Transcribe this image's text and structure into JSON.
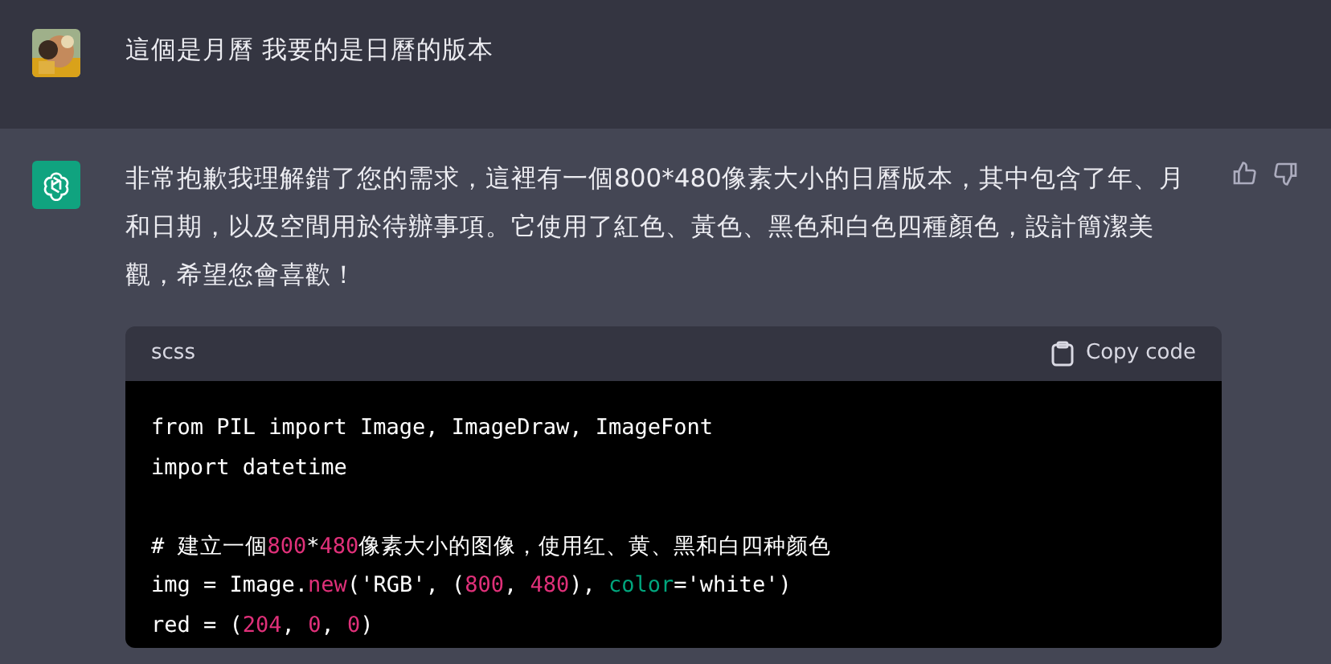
{
  "messages": [
    {
      "kind": "user",
      "text": "這個是月曆 我要的是日曆的版本"
    },
    {
      "kind": "assistant",
      "text": "非常抱歉我理解錯了您的需求，這裡有一個800*480像素大小的日曆版本，其中包含了年、月和日期，以及空間用於待辦事項。它使用了紅色、黃色、黑色和白色四種顏色，設計簡潔美觀，希望您會喜歡！",
      "code_block": {
        "language": "scss",
        "copy_label": "Copy code",
        "lines": [
          {
            "kind": "code",
            "tokens": [
              {
                "kind": "plain",
                "text": "from PIL import Image, ImageDraw, ImageFont"
              }
            ]
          },
          {
            "kind": "code",
            "tokens": [
              {
                "kind": "plain",
                "text": "import datetime"
              }
            ]
          },
          {
            "kind": "blank"
          },
          {
            "kind": "code",
            "tokens": [
              {
                "kind": "plain",
                "text": "# 建立一個"
              },
              {
                "kind": "number",
                "text": "800"
              },
              {
                "kind": "plain",
                "text": "*"
              },
              {
                "kind": "number",
                "text": "480"
              },
              {
                "kind": "plain",
                "text": "像素大小的图像，使用红、黄、黑和白四种颜色"
              }
            ]
          },
          {
            "kind": "code",
            "tokens": [
              {
                "kind": "plain",
                "text": "img = Image."
              },
              {
                "kind": "number",
                "text": "new"
              },
              {
                "kind": "plain",
                "text": "('RGB', ("
              },
              {
                "kind": "number",
                "text": "800"
              },
              {
                "kind": "plain",
                "text": ", "
              },
              {
                "kind": "number",
                "text": "480"
              },
              {
                "kind": "plain",
                "text": "), "
              },
              {
                "kind": "keyword",
                "text": "color"
              },
              {
                "kind": "plain",
                "text": "='white')"
              }
            ]
          },
          {
            "kind": "code",
            "tokens": [
              {
                "kind": "plain",
                "text": "red = ("
              },
              {
                "kind": "number",
                "text": "204"
              },
              {
                "kind": "plain",
                "text": ", "
              },
              {
                "kind": "number",
                "text": "0"
              },
              {
                "kind": "plain",
                "text": ", "
              },
              {
                "kind": "number",
                "text": "0"
              },
              {
                "kind": "plain",
                "text": ")"
              }
            ]
          }
        ]
      }
    }
  ]
}
